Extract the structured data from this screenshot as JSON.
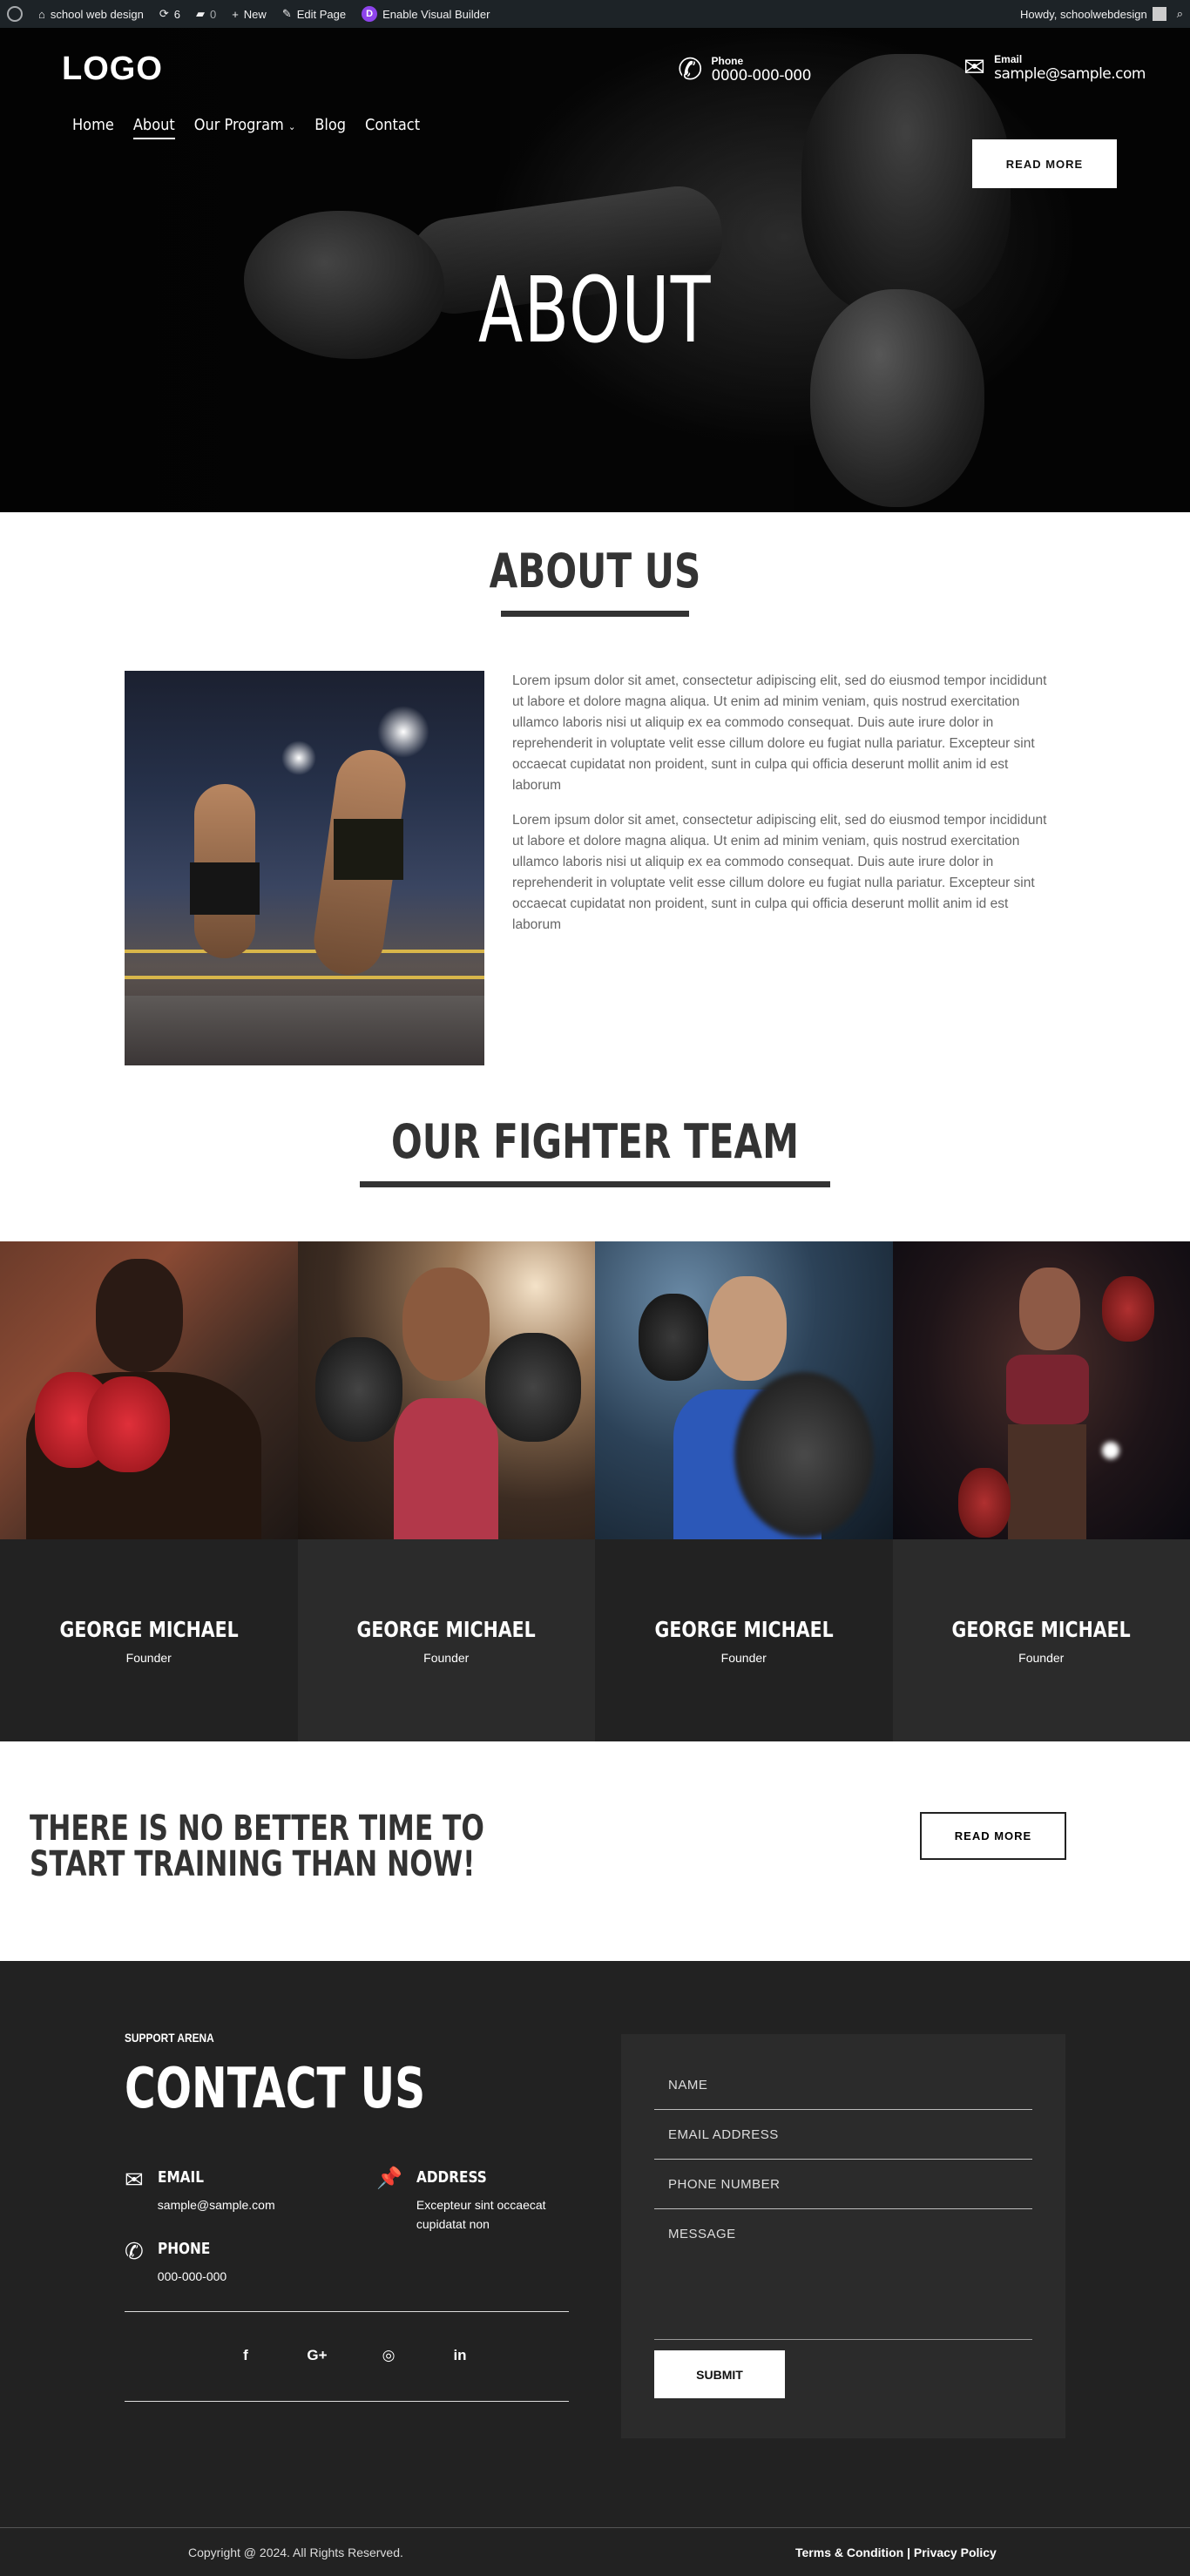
{
  "admin_bar": {
    "site_name": "school web design",
    "updates": "6",
    "comments": "0",
    "new": "New",
    "edit": "Edit Page",
    "visual_builder": "Enable Visual Builder",
    "howdy": "Howdy, schoolwebdesign",
    "divi_letter": "D"
  },
  "header": {
    "logo": "LOGO",
    "nav": [
      "Home",
      "About",
      "Our Program",
      "Blog",
      "Contact"
    ],
    "phone_label": "Phone",
    "phone_value": "0000-000-000",
    "email_label": "Email",
    "email_value": "sample@sample.com",
    "cta": "READ MORE",
    "hero_title": "ABOUT"
  },
  "about": {
    "title": "ABOUT US",
    "p1": "Lorem ipsum dolor sit amet, consectetur adipiscing elit, sed do eiusmod tempor incididunt ut labore et dolore magna aliqua. Ut enim ad minim veniam, quis nostrud exercitation ullamco laboris nisi ut aliquip ex ea commodo consequat. Duis aute irure dolor in reprehenderit in voluptate velit esse cillum dolore eu fugiat nulla pariatur. Excepteur sint occaecat cupidatat non proident, sunt in culpa qui officia deserunt mollit anim id est laborum",
    "p2": "Lorem ipsum dolor sit amet, consectetur adipiscing elit, sed do eiusmod tempor incididunt ut labore et dolore magna aliqua. Ut enim ad minim veniam, quis nostrud exercitation ullamco laboris nisi ut aliquip ex ea commodo consequat. Duis aute irure dolor in reprehenderit in voluptate velit esse cillum dolore eu fugiat nulla pariatur. Excepteur sint occaecat cupidatat non proident, sunt in culpa qui officia deserunt mollit anim id est laborum"
  },
  "team": {
    "title": "OUR FIGHTER TEAM",
    "members": [
      {
        "name": "GEORGE MICHAEL",
        "role": "Founder"
      },
      {
        "name": "GEORGE MICHAEL",
        "role": "Founder"
      },
      {
        "name": "GEORGE MICHAEL",
        "role": "Founder"
      },
      {
        "name": "GEORGE MICHAEL",
        "role": "Founder"
      }
    ]
  },
  "cta": {
    "headline": "THERE IS NO BETTER TIME TO START TRAINING THAN NOW!",
    "button": "READ MORE"
  },
  "contact": {
    "eyebrow": "SUPPORT ARENA",
    "title": "CONTACT US",
    "email_label": "EMAIL",
    "email_value": "sample@sample.com",
    "address_label": "ADDRESS",
    "address_value": "Excepteur sint occaecat cupidatat non",
    "phone_label": "PHONE",
    "phone_value": "000-000-000",
    "socials": [
      "f",
      "G+",
      "◎",
      "in"
    ],
    "form": {
      "name": "NAME",
      "email": "EMAIL ADDRESS",
      "phone": "PHONE NUMBER",
      "message": "MESSAGE",
      "submit": "SUBMIT"
    }
  },
  "footer": {
    "copyright": "Copyright @ 2024. All Rights Reserved.",
    "terms": "Terms & Condition",
    "separator": "|",
    "privacy": "Privacy Policy"
  },
  "colors": {
    "dark": "#222222",
    "admin_bar": "#1d2327",
    "divi": "#8e44ec"
  }
}
